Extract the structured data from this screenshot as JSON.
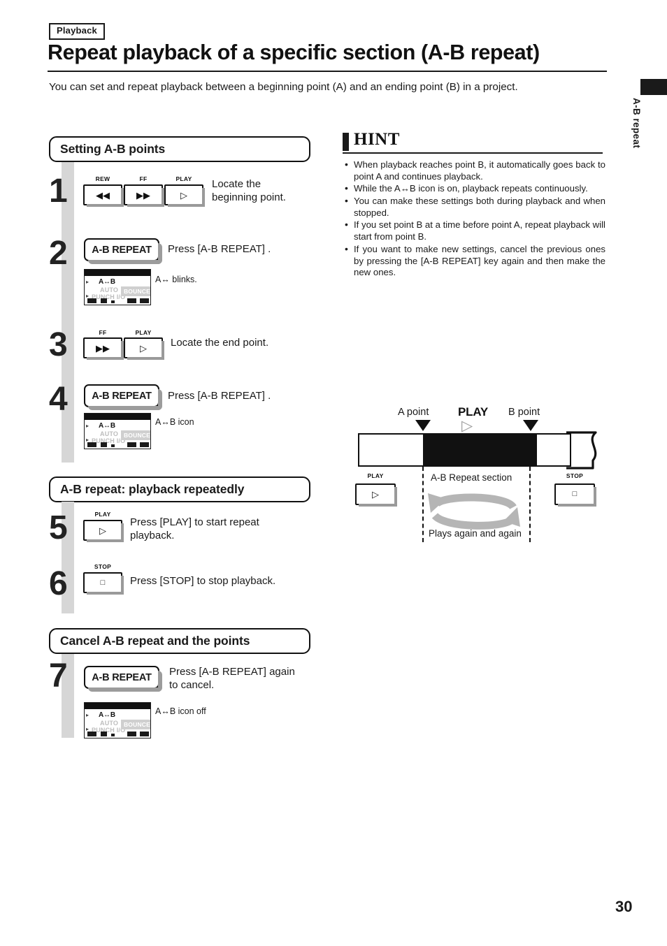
{
  "header": {
    "category_tag": "Playback",
    "title": "Repeat playback of a specific section (A-B repeat)",
    "intro": "You can set and repeat playback between a beginning point (A) and an ending point (B) in a project."
  },
  "margin_tab": {
    "label": "A-B repeat"
  },
  "sections": [
    {
      "id": "setting",
      "title": "Setting A-B points"
    },
    {
      "id": "repeat",
      "title": "A-B repeat: playback repeatedly"
    },
    {
      "id": "cancel",
      "title": "Cancel A-B repeat and the points"
    }
  ],
  "steps": [
    {
      "number": "1",
      "keys": [
        {
          "cap": "REW",
          "glyph": "◀◀"
        },
        {
          "cap": "FF",
          "glyph": "▶▶"
        },
        {
          "cap": "PLAY",
          "glyph": "▷"
        }
      ],
      "instruction": "Locate the\nbeginning point."
    },
    {
      "number": "2",
      "button_label": "A-B REPEAT",
      "instruction": "Press [A-B REPEAT] .",
      "lcd_note": "A↔ blinks."
    },
    {
      "number": "3",
      "keys": [
        {
          "cap": "FF",
          "glyph": "▶▶"
        },
        {
          "cap": "PLAY",
          "glyph": "▷"
        }
      ],
      "instruction": "Locate the end point."
    },
    {
      "number": "4",
      "button_label": "A-B REPEAT",
      "instruction": "Press [A-B REPEAT] .",
      "lcd_note": "A↔B icon"
    },
    {
      "number": "5",
      "keys": [
        {
          "cap": "PLAY",
          "glyph": "▷"
        }
      ],
      "instruction": "Press [PLAY] to start repeat\nplayback."
    },
    {
      "number": "6",
      "keys": [
        {
          "cap": "STOP",
          "glyph": "□"
        }
      ],
      "instruction": "Press [STOP] to stop playback."
    },
    {
      "number": "7",
      "button_label": "A-B REPEAT",
      "instruction": "Press [A-B REPEAT] again\nto cancel.",
      "lcd_note": "A↔B icon off"
    }
  ],
  "lcd": {
    "ab_icon": "A↔B",
    "auto": "AUTO",
    "punch": "PUNCH I/O",
    "bounce": "BOUNCE"
  },
  "hint": {
    "title": "HINT",
    "items": [
      "When playback reaches point B, it automatically goes back to point A and continues playback.",
      "While the A↔B icon is on, playback repeats continuously.",
      "You can make these settings both during playback and when stopped.",
      "If you set point B at a time before point A, repeat playback will start from point B.",
      "If you want to make new settings, cancel the previous ones by pressing the [A-B REPEAT] key again and then make the new ones."
    ]
  },
  "diagram": {
    "a_point_label": "A point",
    "b_point_label": "B point",
    "play_word": "PLAY",
    "play_glyph": "▷",
    "section_label": "A-B Repeat section",
    "loop_label": "Plays again and again",
    "left_key": {
      "cap": "PLAY",
      "glyph": "▷"
    },
    "right_key": {
      "cap": "STOP",
      "glyph": "□"
    }
  },
  "footer": {
    "page_number": "30"
  },
  "colors": {
    "ink": "#1a1a1a",
    "spine_gray": "#d6d6d6",
    "key_shadow": "#9a9a9a",
    "lcd_dim": "#bdbdbd",
    "loop_gray": "#b5b5b5"
  }
}
